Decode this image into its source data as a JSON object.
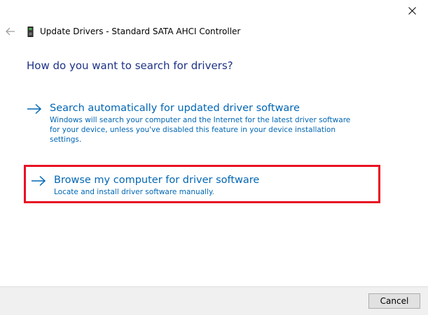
{
  "window": {
    "title": "Update Drivers - Standard SATA AHCI Controller"
  },
  "main": {
    "heading": "How do you want to search for drivers?",
    "options": [
      {
        "title": "Search automatically for updated driver software",
        "description": "Windows will search your computer and the Internet for the latest driver software for your device, unless you've disabled this feature in your device installation settings."
      },
      {
        "title": "Browse my computer for driver software",
        "description": "Locate and install driver software manually."
      }
    ]
  },
  "footer": {
    "cancel_label": "Cancel"
  },
  "colors": {
    "heading": "#1e3287",
    "link": "#0066b4",
    "highlight_border": "#e81123",
    "footer_bg": "#f0f0f0"
  },
  "icons": {
    "close": "close-icon",
    "back": "back-arrow-icon",
    "device": "device-icon",
    "option_arrow": "arrow-right-icon"
  }
}
